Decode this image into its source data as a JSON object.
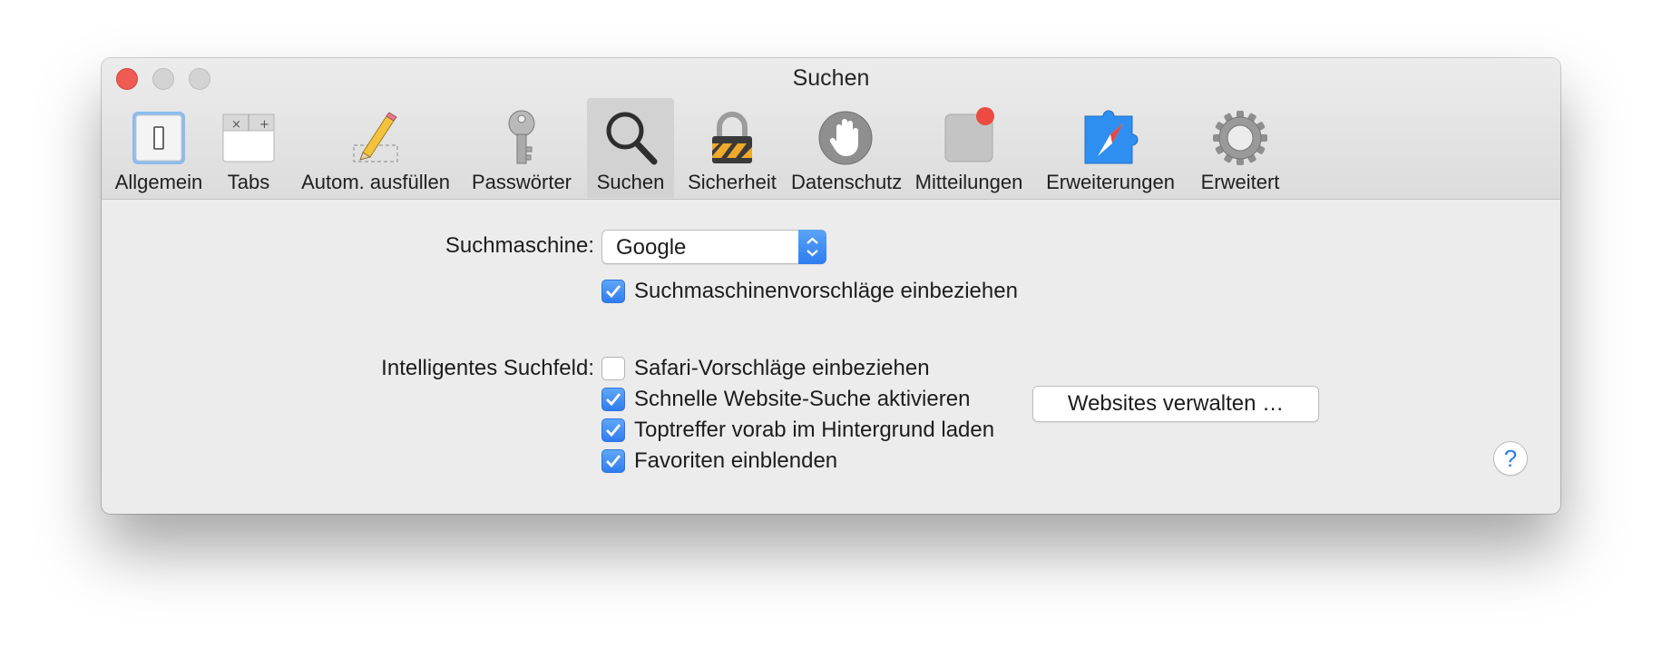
{
  "window": {
    "title": "Suchen"
  },
  "toolbar": {
    "items": [
      {
        "label": "Allgemein",
        "icon": "general-switch-icon"
      },
      {
        "label": "Tabs",
        "icon": "tabs-icon"
      },
      {
        "label": "Autom. ausfüllen",
        "icon": "pencil-icon"
      },
      {
        "label": "Passwörter",
        "icon": "key-icon"
      },
      {
        "label": "Suchen",
        "icon": "magnifier-icon",
        "selected": true
      },
      {
        "label": "Sicherheit",
        "icon": "lock-icon"
      },
      {
        "label": "Datenschutz",
        "icon": "hand-icon"
      },
      {
        "label": "Mitteilungen",
        "icon": "notification-icon"
      },
      {
        "label": "Erweiterungen",
        "icon": "puzzle-compass-icon"
      },
      {
        "label": "Erweitert",
        "icon": "gear-icon"
      }
    ]
  },
  "search": {
    "engine_label": "Suchmaschine:",
    "engine_value": "Google",
    "suggestions": {
      "label": "Suchmaschinenvorschläge einbeziehen",
      "checked": true
    },
    "smart_field_label": "Intelligentes Suchfeld:",
    "options": [
      {
        "label": "Safari-Vorschläge einbeziehen",
        "checked": false
      },
      {
        "label": "Schnelle Website-Suche aktivieren",
        "checked": true
      },
      {
        "label": "Toptreffer vorab im Hintergrund laden",
        "checked": true
      },
      {
        "label": "Favoriten einblenden",
        "checked": true
      }
    ],
    "manage_websites_button": "Websites verwalten …",
    "help_button": "?"
  },
  "colors": {
    "accent": "#2f7cf0",
    "close": "#ee5b52"
  }
}
